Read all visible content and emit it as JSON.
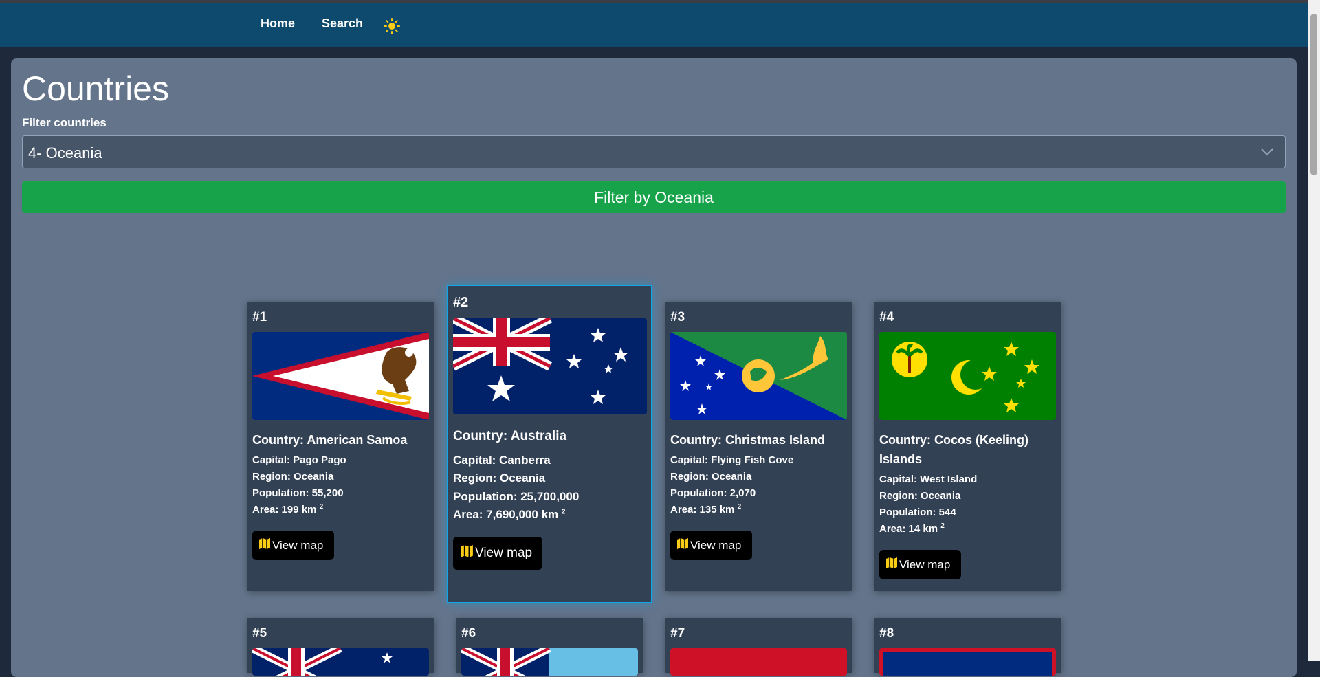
{
  "nav": {
    "home": "Home",
    "search": "Search",
    "theme_icon": "sun-icon"
  },
  "page": {
    "title": "Countries",
    "filter_label": "Filter countries",
    "filter_value": "4- Oceania",
    "filter_button": "Filter by Oceania"
  },
  "cards": [
    {
      "num": "#1",
      "country": "Country: American Samoa",
      "capital": "Capital: Pago Pago",
      "region": "Region: Oceania",
      "population": "Population: 55,200",
      "area": "Area: 199 km",
      "area_unit_sup": "2",
      "map_button": "View map"
    },
    {
      "num": "#2",
      "country": "Country: Australia",
      "capital": "Capital: Canberra",
      "region": "Region: Oceania",
      "population": "Population: 25,700,000",
      "area": "Area: 7,690,000 km",
      "area_unit_sup": "2",
      "map_button": "View map"
    },
    {
      "num": "#3",
      "country": "Country: Christmas Island",
      "capital": "Capital: Flying Fish Cove",
      "region": "Region: Oceania",
      "population": "Population: 2,070",
      "area": "Area: 135 km",
      "area_unit_sup": "2",
      "map_button": "View map"
    },
    {
      "num": "#4",
      "country": "Country: Cocos (Keeling) Islands",
      "capital": "Capital: West Island",
      "region": "Region: Oceania",
      "population": "Population: 544",
      "area": "Area: 14 km",
      "area_unit_sup": "2",
      "map_button": "View map"
    },
    {
      "num": "#5"
    },
    {
      "num": "#6"
    },
    {
      "num": "#7"
    },
    {
      "num": "#8"
    }
  ],
  "colors": {
    "navbar": "#0d4a6e",
    "main_bg": "#64748b",
    "card_bg": "#334155",
    "filter_button": "#16a34a",
    "featured_border": "#0ea5e9"
  }
}
